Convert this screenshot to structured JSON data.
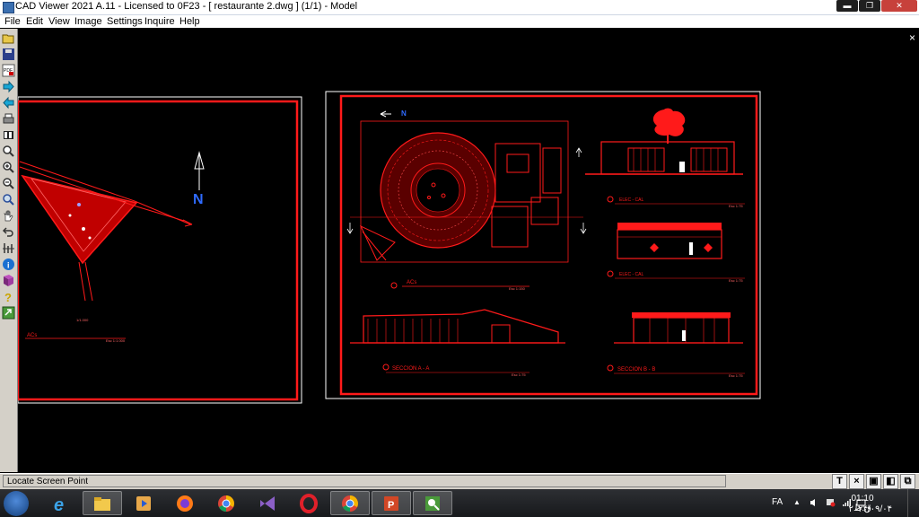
{
  "window": {
    "title": "CAD Viewer 2021 A.11 - Licensed to 0F23 - [ restaurante 2.dwg ] (1/1) - Model",
    "minimize": "▬",
    "maximize": "❐",
    "close": "✕"
  },
  "menu": [
    "File",
    "Edit",
    "View",
    "Image",
    "Settings",
    "Inquire",
    "Help"
  ],
  "toolbar": {
    "tools": [
      "open-icon",
      "save-icon",
      "pdf-icon",
      "forward-icon",
      "back-icon",
      "print-icon",
      "layers-icon",
      "zoom-icon",
      "zoom-in-icon",
      "zoom-out-icon",
      "zoom-extents-icon",
      "pan-icon",
      "undo-icon",
      "measure-icon",
      "info-icon",
      "book-icon",
      "help-icon",
      "export-icon"
    ]
  },
  "drawing": {
    "north_label": "N",
    "left_scale_label": "1/1.000",
    "left_section_label": "ACs",
    "left_scale_note": "Esc 1:1.000",
    "plan_section_label": "ACs",
    "plan_scale_note": "Esc 1:150",
    "elev1_label": "ELEC - CAL",
    "elev2_label": "ELEC - CAL",
    "section_a": "SECCION A - A",
    "section_b": "SECCION B - B",
    "scale_note": "Esc 1:75"
  },
  "canvas": {
    "close": "×"
  },
  "status": {
    "text": "Locate Screen Point",
    "tools": [
      "T",
      "×",
      "▣",
      "◧",
      "⧉"
    ]
  },
  "taskbar": {
    "apps": [
      "ie-icon",
      "file-explorer-icon",
      "media-player-icon",
      "firefox-icon",
      "chrome-icon",
      "visual-studio-icon",
      "opera-icon",
      "chrome-profile-icon",
      "powerpoint-icon",
      "cad-viewer-icon"
    ],
    "lang": "FA",
    "time": "01:10 ق.ظ",
    "date": "۲۰۲۴/۰۹/۰۴"
  },
  "colors": {
    "cad_line": "#ff1a1a",
    "cad_white": "#ffffff",
    "north_blue": "#2f6bff",
    "canvas_bg": "#000000"
  }
}
